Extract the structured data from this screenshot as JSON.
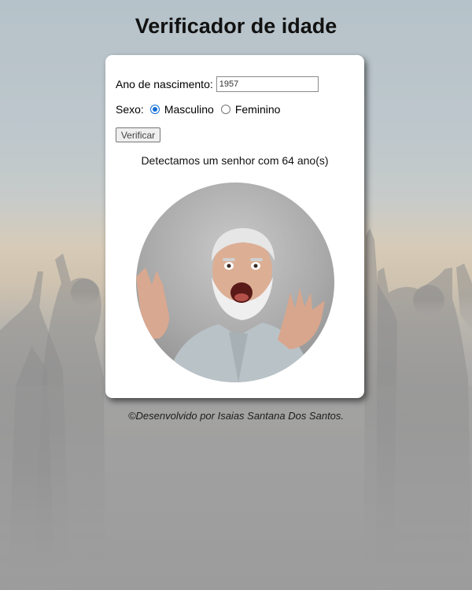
{
  "page": {
    "title": "Verificador de idade"
  },
  "form": {
    "year_label": "Ano de nascimento:",
    "year_value": "1957",
    "sex_label": "Sexo:",
    "options": [
      {
        "label": "Masculino",
        "checked": true
      },
      {
        "label": "Feminino",
        "checked": false
      }
    ],
    "button_label": "Verificar"
  },
  "result": {
    "text": "Detectamos um senhor com 64 ano(s)"
  },
  "photo": {
    "subject": "elderly man with white beard shouting"
  },
  "footer": {
    "text": "©Desenvolvido por Isaias Santana Dos Santos."
  },
  "colors": {
    "accent": "#0f6fd6",
    "card": "#ffffff"
  }
}
